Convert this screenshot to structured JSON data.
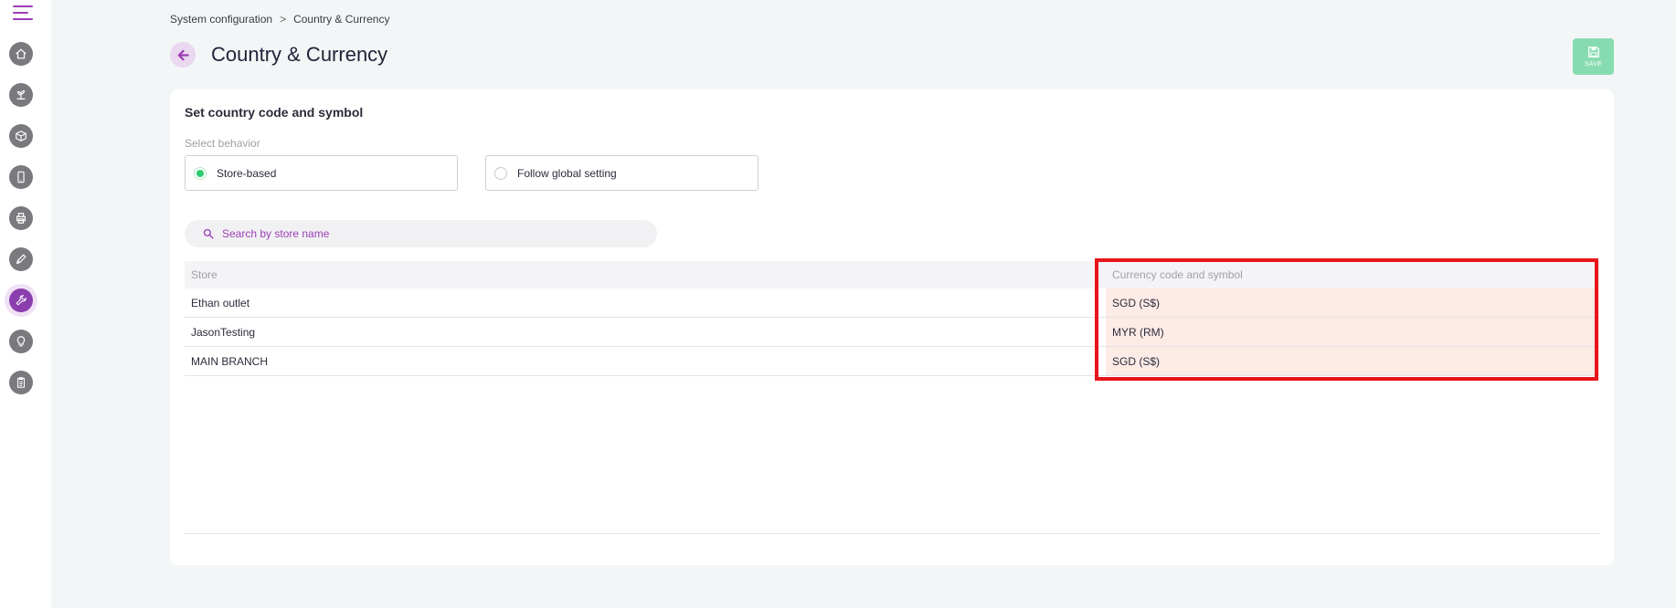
{
  "breadcrumb": {
    "parent": "System configuration",
    "separator": ">",
    "current": "Country & Currency"
  },
  "page": {
    "title": "Country & Currency"
  },
  "toolbar": {
    "save_label": "SAVE"
  },
  "section": {
    "title": "Set country code and symbol",
    "behavior_label": "Select behavior"
  },
  "behavior_options": [
    {
      "label": "Store-based",
      "selected": true
    },
    {
      "label": "Follow global setting",
      "selected": false
    }
  ],
  "search": {
    "placeholder": "Search by store name",
    "value": ""
  },
  "table": {
    "headers": [
      "Store",
      "Currency code and symbol"
    ],
    "rows": [
      {
        "store": "Ethan outlet",
        "currency": "SGD (S$)"
      },
      {
        "store": "JasonTesting",
        "currency": "MYR (RM)"
      },
      {
        "store": "MAIN BRANCH",
        "currency": "SGD (S$)"
      }
    ]
  },
  "sidebar": {
    "items": [
      {
        "icon": "home-icon"
      },
      {
        "icon": "plant-icon"
      },
      {
        "icon": "cube-icon"
      },
      {
        "icon": "mobile-icon"
      },
      {
        "icon": "printer-icon"
      },
      {
        "icon": "pen-icon"
      },
      {
        "icon": "wrench-icon",
        "active": true
      },
      {
        "icon": "lightbulb-icon"
      },
      {
        "icon": "clipboard-icon"
      }
    ]
  },
  "colors": {
    "accent": "#8b3fae",
    "save": "#86dcb0",
    "highlight": "#e8141b",
    "radio_selected": "#2ecc71",
    "currency_column_bg": "#fdebe6"
  }
}
